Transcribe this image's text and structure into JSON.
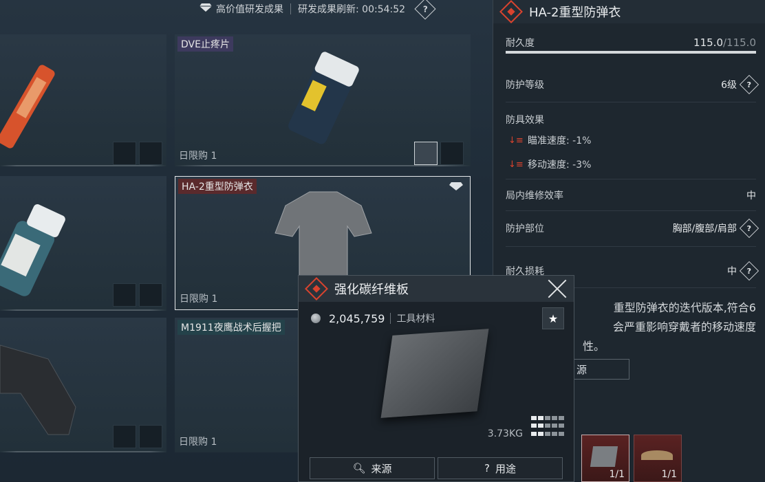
{
  "topbar": {
    "high_value_label": "高价值研发成果",
    "refresh_label": "研发成果刷新: 00:54:52",
    "help": "?"
  },
  "grid": {
    "items": [
      {
        "name": "DVE止疼片",
        "limit": "日限购 1"
      },
      {
        "name": "HA-2重型防弹衣",
        "limit": "日限购 1"
      },
      {
        "name": "M1911夜鹰战术后握把",
        "limit": "日限购 1"
      }
    ]
  },
  "panel": {
    "title": "HA-2重型防弹衣",
    "durability_label": "耐久度",
    "durability_current": "115.0",
    "durability_max": "/115.0",
    "durability_fraction": 1.0,
    "protection_level_label": "防护等级",
    "protection_level_value": "6级",
    "armor_effect_label": "防具效果",
    "effects": [
      {
        "label": "瞄准速度:",
        "value": "-1%"
      },
      {
        "label": "移动速度:",
        "value": "-3%"
      }
    ],
    "repair_label": "局内维修效率",
    "repair_value": "中",
    "area_label": "防护部位",
    "area_value": "胸部/腹部/肩部",
    "wear_label": "耐久损耗",
    "wear_value": "中",
    "desc_line1": "重型防弹衣的迭代版本,符合6",
    "desc_line2": "会严重影响穿戴者的移动速度",
    "desc_line3": "性。",
    "source_btn": "源",
    "slots": [
      {
        "count": "1/1"
      },
      {
        "count": "1/1"
      }
    ]
  },
  "popup": {
    "title": "强化碳纤维板",
    "price": "2,045,759",
    "category": "工具材料",
    "weight": "3.73KG",
    "source_btn": "来源",
    "use_btn": "用途"
  },
  "colors": {
    "accent_red": "#d9432e",
    "panel_bg": "#1e272f"
  }
}
